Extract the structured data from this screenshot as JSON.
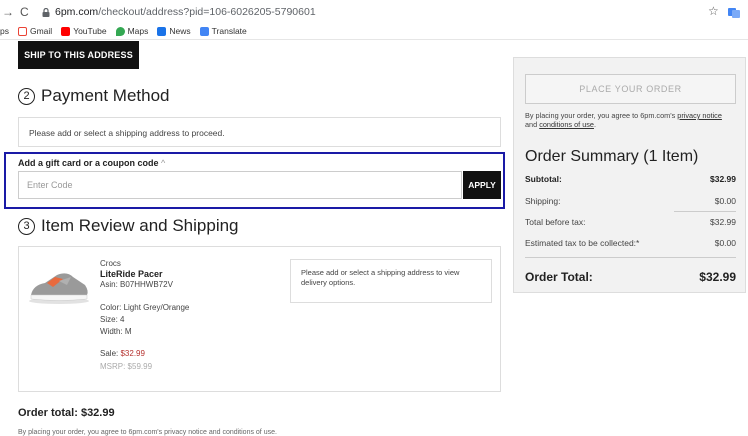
{
  "browser": {
    "back": "←",
    "forward": "→",
    "reload": "C",
    "host": "6pm.com",
    "path": "/checkout/address?pid=106-6026205-5790601",
    "bookmarks": [
      {
        "label": "ps",
        "color": "#ffffff"
      },
      {
        "label": "Gmail",
        "color": "#ea4335"
      },
      {
        "label": "YouTube",
        "color": "#ff0000"
      },
      {
        "label": "Maps",
        "color": "#34a853"
      },
      {
        "label": "News",
        "color": "#1a73e8"
      },
      {
        "label": "Translate",
        "color": "#4285f4"
      }
    ]
  },
  "page": {
    "ship_btn": "SHIP TO THIS ADDRESS",
    "payment": {
      "num": "2",
      "title": "Payment Method",
      "notice": "Please add or select a shipping address to proceed."
    },
    "gift": {
      "label": "Add a gift card or a coupon code",
      "caret": "^",
      "placeholder": "Enter Code",
      "apply": "APPLY"
    },
    "review": {
      "num": "3",
      "title": "Item Review and Shipping"
    },
    "item": {
      "brand": "Crocs",
      "name": "LiteRide Pacer",
      "asin": "Asin: B07HHWB72V",
      "color": "Color: Light Grey/Orange",
      "size": "Size: 4",
      "width": "Width: M",
      "sale_label": "Sale: ",
      "sale_price": "$32.99",
      "msrp": "MSRP: $59.99",
      "ship_note": "Please add or select a shipping address to view delivery options."
    },
    "order_total": "Order total: $32.99",
    "fine_print": "By placing your order, you agree to 6pm.com's privacy notice and conditions of use."
  },
  "summary": {
    "place_order": "PLACE YOUR ORDER",
    "agree_pre": "By placing your order, you agree to 6pm.com's ",
    "privacy": "privacy notice",
    "and": "and ",
    "conditions": "conditions of use",
    "period": ".",
    "title": "Order Summary (1 Item)",
    "rows": [
      {
        "label": "Subtotal:",
        "value": "$32.99"
      },
      {
        "label": "Shipping:",
        "value": "$0.00"
      },
      {
        "label": "Total before tax:",
        "value": "$32.99"
      },
      {
        "label": "Estimated tax to be collected:*",
        "value": "$0.00"
      }
    ],
    "total_label": "Order Total:",
    "total_value": "$32.99"
  },
  "colors": {
    "sale": "#b5322f",
    "highlight_border": "#1a1aa6"
  }
}
